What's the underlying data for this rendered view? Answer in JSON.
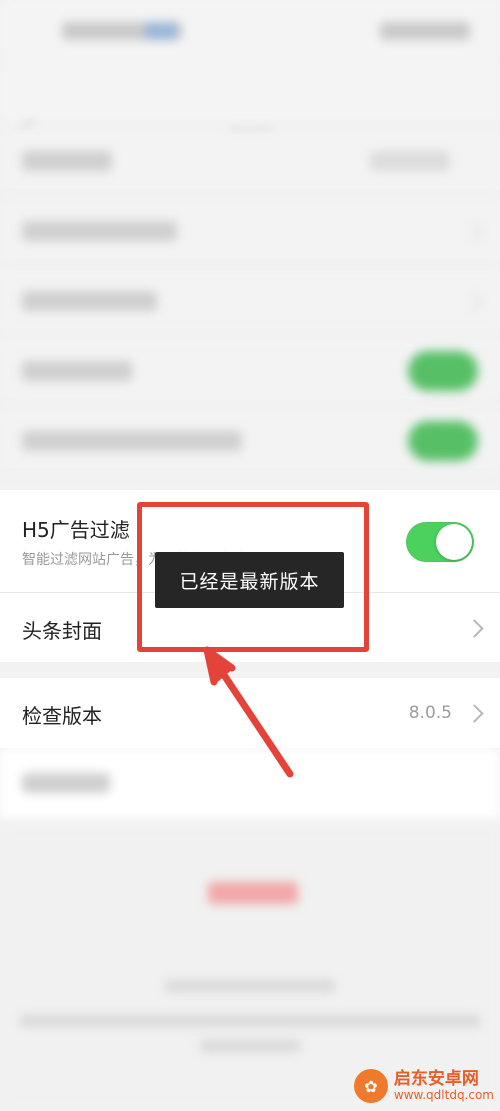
{
  "settings": {
    "ad_filter": {
      "title": "H5广告过滤",
      "subtitle": "智能过滤网站广告，为你节省更多流量",
      "enabled": true
    },
    "headline_cover": {
      "title": "头条封面"
    },
    "check_version": {
      "title": "检查版本",
      "version": "8.0.5"
    }
  },
  "toast": {
    "message": "已经是最新版本"
  },
  "annotation": {
    "highlight_color": "#e4433a"
  },
  "watermark": {
    "name": "启东安卓网",
    "url": "www.qdltdq.com"
  },
  "colors": {
    "toggle_on": "#4cd15f",
    "toast_bg": "#262626"
  }
}
